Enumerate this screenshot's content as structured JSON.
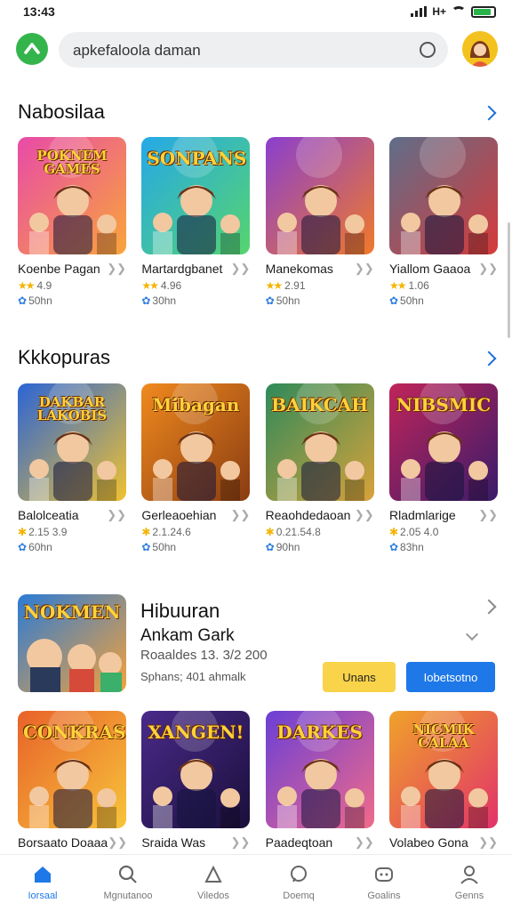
{
  "status": {
    "time": "13:43",
    "network": "H+",
    "battery_level": 0.85
  },
  "search": {
    "text": "apkefaloola daman"
  },
  "logo": {
    "icon": "app-logo-icon",
    "color": "#34b54c"
  },
  "sections": [
    {
      "title": "Nabosilaa",
      "cards": [
        {
          "name": "Koenbe Pagan",
          "rating": "4.9",
          "stars": "★★",
          "size": "50hn",
          "thumb_text": "POKNEM GAMES",
          "palette": [
            "#e84aa8",
            "#f9a53a"
          ]
        },
        {
          "name": "Martardgbanet",
          "rating": "4.96",
          "stars": "★★",
          "size": "30hn",
          "thumb_text": "SONPANS",
          "palette": [
            "#25a8e8",
            "#56d46f"
          ]
        },
        {
          "name": "Manekomas",
          "rating": "2.91",
          "stars": "★★",
          "size": "50hn",
          "thumb_text": "",
          "palette": [
            "#8a3fcf",
            "#f07a2a"
          ]
        },
        {
          "name": "Yiallom Gaaoa",
          "rating": "1.06",
          "stars": "★★",
          "size": "50hn",
          "thumb_text": "",
          "palette": [
            "#5f6e8a",
            "#d63a3a"
          ]
        }
      ]
    },
    {
      "title": "Kkkopuras",
      "cards": [
        {
          "name": "Balolceatia",
          "rating": "2.15 3.9",
          "stars": "",
          "size": "60hn",
          "thumb_text": "DAKBAR LAKOBIS",
          "palette": [
            "#2a64d6",
            "#f0c230"
          ]
        },
        {
          "name": "Gerleaoehian",
          "rating": "2.1.24.6",
          "stars": "",
          "size": "50hn",
          "thumb_text": "Mibagan",
          "palette": [
            "#f08a1e",
            "#8a3c12"
          ]
        },
        {
          "name": "Reaohdedaoan",
          "rating": "0.21.54.8",
          "stars": "",
          "size": "90hn",
          "thumb_text": "BAIKCAH",
          "palette": [
            "#2e8a5a",
            "#d8a23a"
          ]
        },
        {
          "name": "Rladmlarige",
          "rating": "2.05 4.0",
          "stars": "",
          "size": "83hn",
          "thumb_text": "NIBSMIC",
          "palette": [
            "#c0245a",
            "#3a1c6a"
          ]
        }
      ]
    }
  ],
  "featured": {
    "title": "Hibuuran",
    "subtitle": "Ankam Gark",
    "meta": "Roaaldes 13. 3/2 200",
    "meta2": "Sphans; 401 ahmalk",
    "button_secondary": "Unans",
    "button_primary": "Iobetsotno",
    "thumb_text": "NOKMEN"
  },
  "bottom_row": [
    {
      "name": "Borsaato Doaaa",
      "thumb_text": "CONKRAS",
      "palette": [
        "#e8622a",
        "#f7c43a"
      ]
    },
    {
      "name": "Sraida Was",
      "thumb_text": "XANGEN!",
      "palette": [
        "#4a2a8a",
        "#1a0f3a"
      ]
    },
    {
      "name": "Paadeqtoan",
      "thumb_text": "DARKES",
      "palette": [
        "#6a3fd6",
        "#f06a8a"
      ]
    },
    {
      "name": "Volabeo Gona",
      "thumb_text": "NICMIK CALAA",
      "palette": [
        "#f0a22a",
        "#e2326a"
      ]
    }
  ],
  "nav": [
    {
      "label": "Iorsaal",
      "icon": "home-icon",
      "active": true
    },
    {
      "label": "Mgnutanoo",
      "icon": "search-icon",
      "active": false
    },
    {
      "label": "Viledos",
      "icon": "app-icon",
      "active": false
    },
    {
      "label": "Doemq",
      "icon": "chat-icon",
      "active": false
    },
    {
      "label": "Goalins",
      "icon": "games-icon",
      "active": false
    },
    {
      "label": "Genns",
      "icon": "profile-icon",
      "active": false
    }
  ]
}
